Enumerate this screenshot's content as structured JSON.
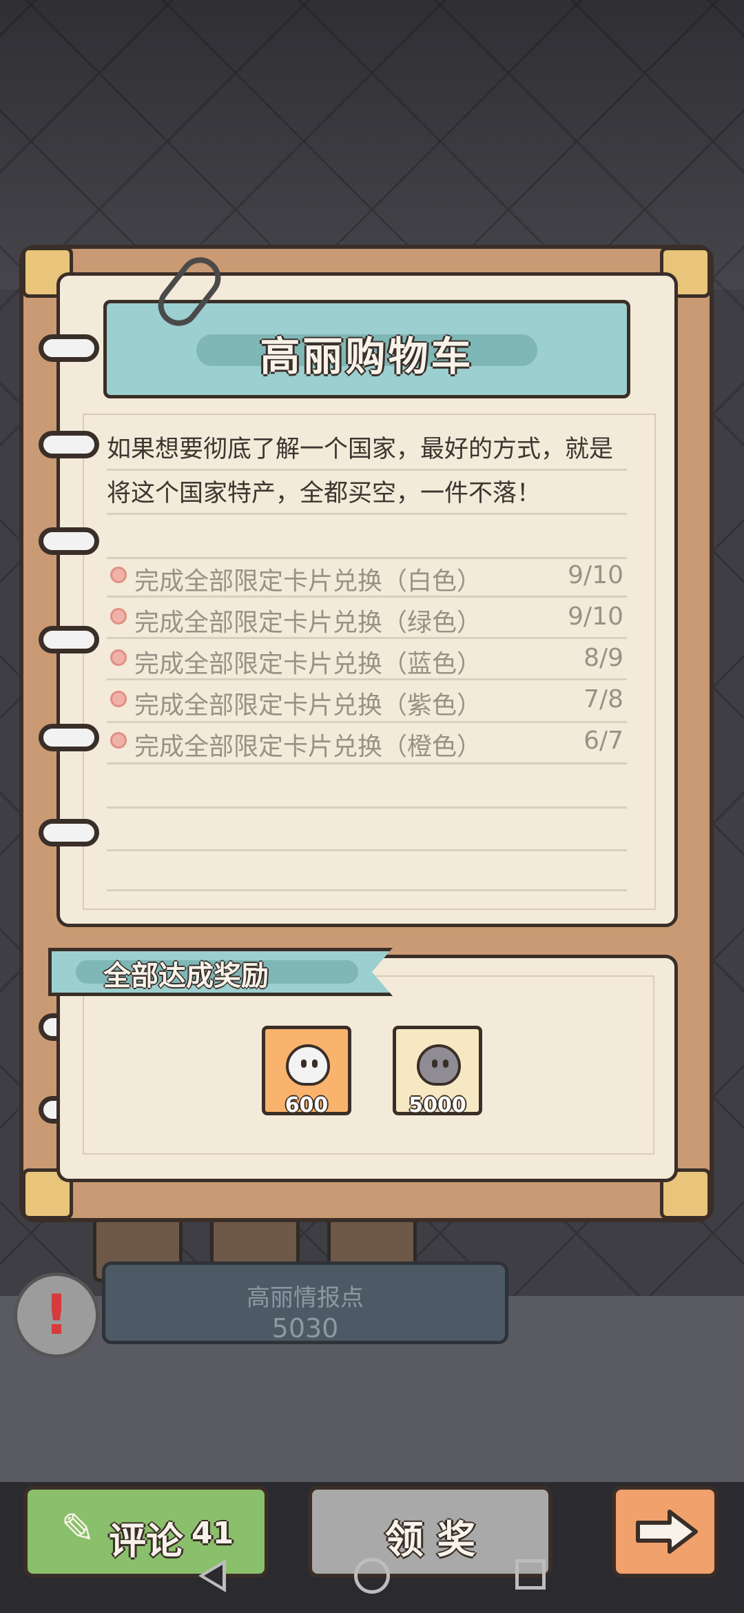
{
  "notebook": {
    "title": "高丽购物车",
    "description": "如果想要彻底了解一个国家，最好的方式，就是将这个国家特产，全都买空，一件不落！",
    "tasks": [
      {
        "label": "完成全部限定卡片兑换（白色）",
        "progress": "9/10"
      },
      {
        "label": "完成全部限定卡片兑换（绿色）",
        "progress": "9/10"
      },
      {
        "label": "完成全部限定卡片兑换（蓝色）",
        "progress": "8/9"
      },
      {
        "label": "完成全部限定卡片兑换（紫色）",
        "progress": "7/8"
      },
      {
        "label": "完成全部限定卡片兑换（橙色）",
        "progress": "6/7"
      }
    ]
  },
  "reward": {
    "title": "全部达成奖励",
    "items": [
      {
        "icon": "white-ghost-icon",
        "amount": "600",
        "color": "#f9b36c"
      },
      {
        "icon": "gray-ghost-icon",
        "amount": "5000",
        "color": "#f7e8c4"
      }
    ]
  },
  "info": {
    "label": "高丽情报点",
    "value": "5030"
  },
  "buttons": {
    "comment_label": "评论",
    "comment_count": "41",
    "claim_label": "领 奖",
    "next_icon": "arrow-right-icon"
  },
  "colors": {
    "banner": "#9ccfcf",
    "frame": "#c99a73",
    "page": "#f4ead9",
    "comment_button": "#8ac06b",
    "claim_button": "#a9a9a9",
    "next_button": "#f1a16b"
  }
}
